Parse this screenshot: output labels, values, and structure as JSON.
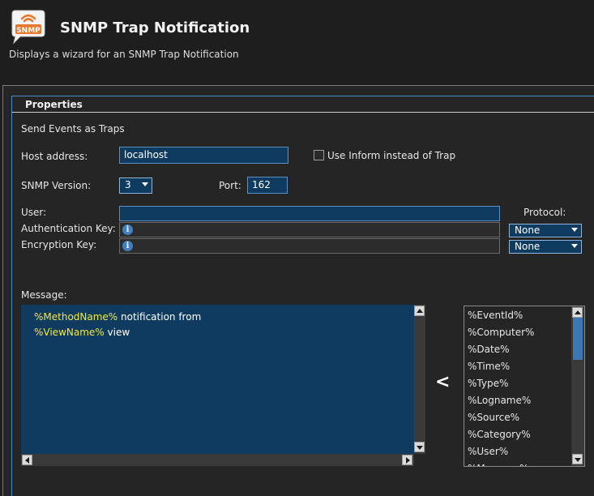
{
  "header": {
    "logo_text": "SNMP",
    "title": "SNMP Trap Notification",
    "subtitle": "Displays a wizard for an SNMP Trap Notification"
  },
  "panel": {
    "title": "Properties",
    "section_label": "Send Events as Traps"
  },
  "host": {
    "label": "Host address:",
    "value": "localhost"
  },
  "inform": {
    "label": "Use Inform instead of Trap",
    "checked": false
  },
  "version": {
    "label": "SNMP Version:",
    "value": "3"
  },
  "port": {
    "label": "Port:",
    "value": "162"
  },
  "user": {
    "label": "User:",
    "value": ""
  },
  "protocol": {
    "label": "Protocol:"
  },
  "auth": {
    "label": "Authentication Key:",
    "protocol": "None"
  },
  "encryption": {
    "label": "Encryption Key:",
    "protocol": "None"
  },
  "message": {
    "label": "Message:",
    "line1_var": "%MethodName%",
    "line1_text": " notification from",
    "line2_var": "%ViewName%",
    "line2_text": " view"
  },
  "insert_glyph": "<",
  "variables": [
    "%EventId%",
    "%Computer%",
    "%Date%",
    "%Time%",
    "%Type%",
    "%Logname%",
    "%Source%",
    "%Category%",
    "%User%",
    "%Message%"
  ],
  "icons": {
    "logo": "snmp-bubble-icon",
    "info": "info-icon"
  },
  "colors": {
    "field_bg": "#0f3b60",
    "variable_highlight": "#f5e642",
    "logo_orange": "#e8762b"
  }
}
